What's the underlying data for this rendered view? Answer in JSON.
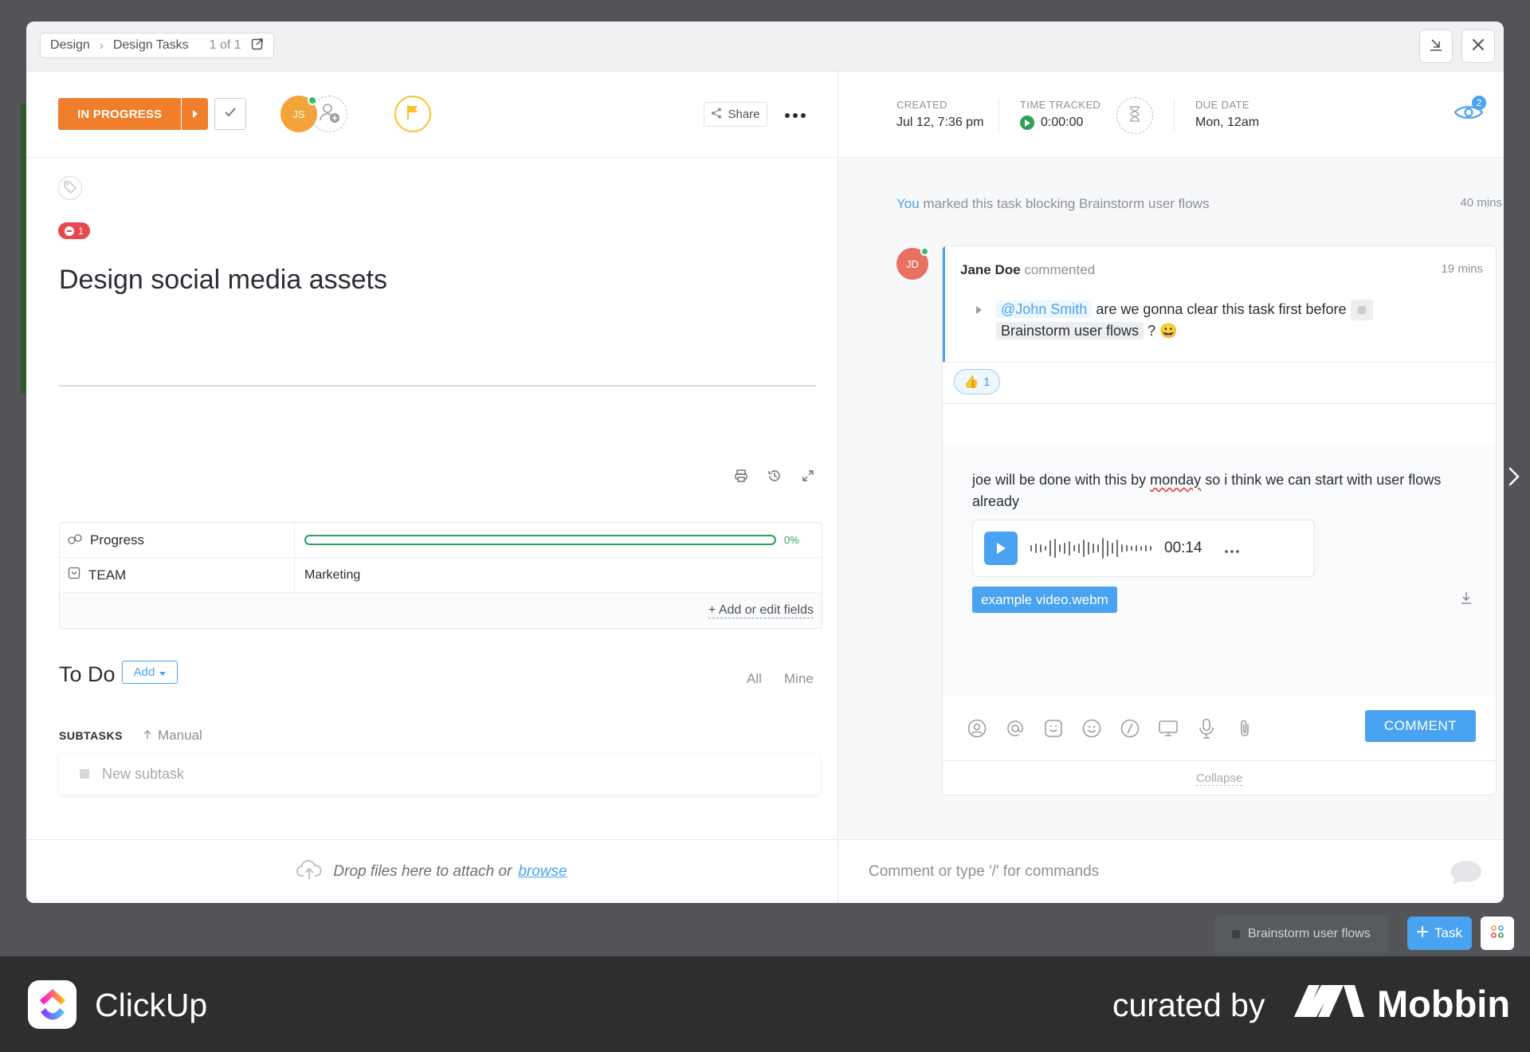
{
  "background": {
    "queued_task": "Brainstorm user flows",
    "task_button": "Task",
    "task_button_icon": "plus"
  },
  "breadcrumb": {
    "space": "Design",
    "list": "Design Tasks",
    "position": "1 of 1"
  },
  "task": {
    "status": "IN PROGRESS",
    "status_color": "#f07e2b",
    "assignee_initials": "JS",
    "share_label": "Share",
    "blocking_count": "1",
    "title": "Design social media assets",
    "progress_percent": 0,
    "progress_label": "0%",
    "fields": [
      {
        "name": "Progress",
        "value": "0%"
      },
      {
        "name": "TEAM",
        "value": "Marketing"
      }
    ],
    "add_fields_label": "+ Add or edit fields"
  },
  "todo": {
    "title": "To Do",
    "add_label": "Add",
    "filter_all": "All",
    "filter_mine": "Mine",
    "subtasks_label": "SUBTASKS",
    "sort_label": "Manual",
    "new_subtask_placeholder": "New subtask"
  },
  "meta": {
    "created_label": "CREATED",
    "created_value": "Jul 12, 7:36 pm",
    "time_tracked_label": "TIME TRACKED",
    "time_tracked_value": "0:00:00",
    "due_label": "DUE DATE",
    "due_value": "Mon, 12am",
    "watchers_count": "2"
  },
  "activity": {
    "actor": "You",
    "text": "marked this task blocking Brainstorm user flows",
    "time": "40 mins"
  },
  "comment": {
    "avatar_initials": "JD",
    "author": "Jane Doe",
    "verb": "commented",
    "time": "19 mins",
    "mention": "@John Smith",
    "text_part1": "are we gonna clear this task first before",
    "linked_task": "Brainstorm user flows",
    "text_part2": "?",
    "emoji": "😀",
    "reaction_emoji": "👍",
    "reaction_count": "1"
  },
  "reply": {
    "text_before": "joe will be done with this by",
    "text_flagged": "monday",
    "text_after": "so i think we can start with user flows already",
    "voice_duration": "00:14",
    "attachment": "example video.webm",
    "submit_label": "COMMENT",
    "collapse_label": "Collapse",
    "toolbar_icons": [
      "assign-icon",
      "mention-icon",
      "emoji-reaction-icon",
      "smiley-icon",
      "slash-command-icon",
      "screen-record-icon",
      "microphone-icon",
      "attachment-icon"
    ]
  },
  "footer": {
    "drop_text": "Drop files here to attach or",
    "browse_label": "browse",
    "comment_placeholder": "Comment or type '/' for commands"
  },
  "branding": {
    "app_name": "ClickUp",
    "curated_by": "curated by",
    "curator": "Mobbin"
  },
  "colors": {
    "accent": "#49a3f1",
    "progress": "#2f9e59",
    "priority_flag": "#f7c32e",
    "blocking": "#e5484d"
  }
}
